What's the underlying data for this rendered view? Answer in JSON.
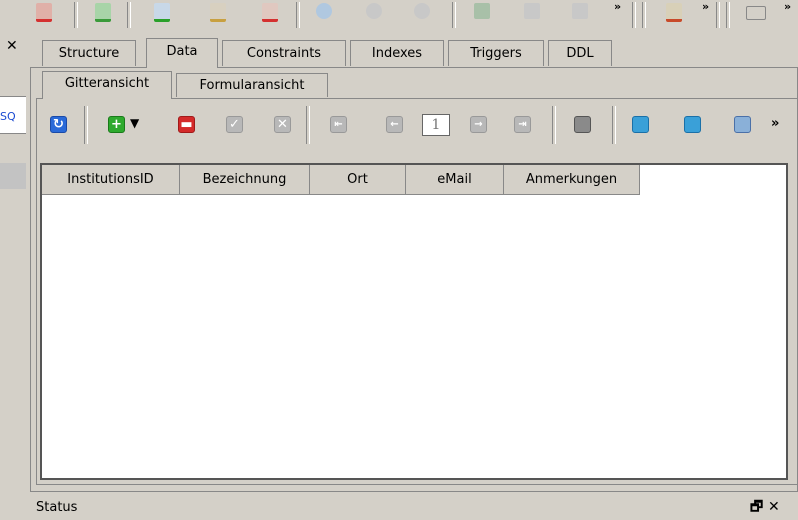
{
  "tabs": [
    {
      "label": "Structure"
    },
    {
      "label": "Data"
    },
    {
      "label": "Constraints"
    },
    {
      "label": "Indexes"
    },
    {
      "label": "Triggers"
    },
    {
      "label": "DDL"
    }
  ],
  "active_tab": "Data",
  "subtabs": [
    {
      "label": "Gitteransicht"
    },
    {
      "label": "Formularansicht"
    }
  ],
  "active_subtab": "Gitteransicht",
  "left_panel": {
    "close": "✕",
    "field_text": "SQ"
  },
  "toolbar": {
    "overflow": "»",
    "page_number": "1"
  },
  "grid": {
    "columns": [
      "InstitutionsID",
      "Bezeichnung",
      "Ort",
      "eMail",
      "Anmerkungen"
    ],
    "rows": []
  },
  "status": {
    "label": "Status",
    "restore": "🗗",
    "close": "✕"
  },
  "colors": {
    "bg": "#d4d0c8",
    "accent_blue": "#1a4ad1",
    "add_green": "#2eaa2e",
    "remove_red": "#d42a2a"
  }
}
